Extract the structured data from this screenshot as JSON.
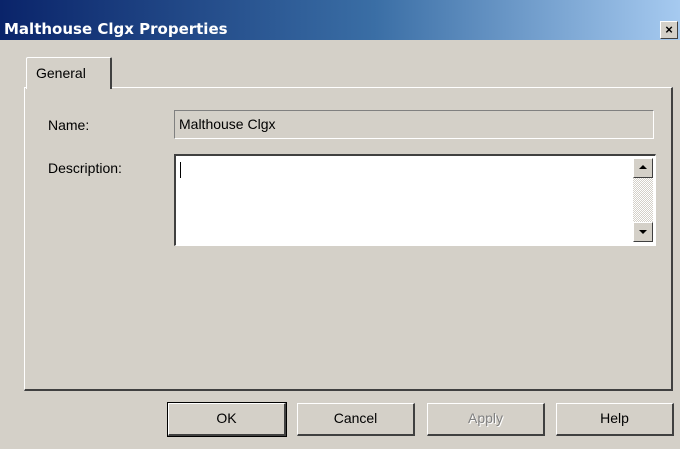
{
  "window": {
    "title": "Malthouse Clgx Properties",
    "close_glyph": "×"
  },
  "tabs": [
    {
      "label": "General",
      "selected": true
    }
  ],
  "form": {
    "name_label": "Name:",
    "name_value": "Malthouse Clgx",
    "description_label": "Description:",
    "description_value": ""
  },
  "buttons": {
    "ok": "OK",
    "cancel": "Cancel",
    "apply": "Apply",
    "help": "Help"
  }
}
